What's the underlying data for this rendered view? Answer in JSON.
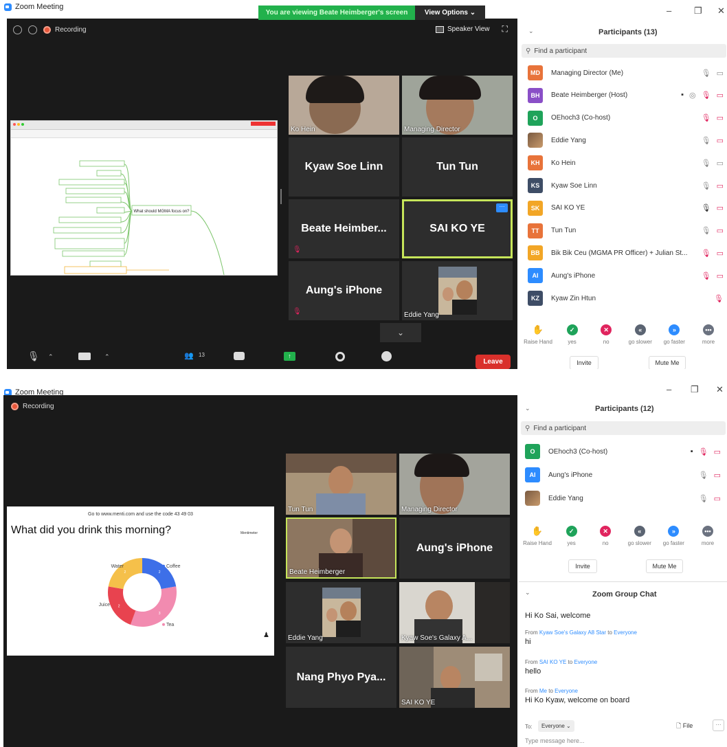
{
  "w1": {
    "title": "Zoom Meeting",
    "banner_view": "You are viewing Beate Heimberger's screen",
    "banner_options": "View Options ⌄",
    "recording": "Recording",
    "speaker_view": "Speaker View",
    "tiles": [
      {
        "name": "Ko Hein",
        "video": true
      },
      {
        "name": "Managing Director",
        "video": true
      },
      {
        "big": "Kyaw Soe Linn"
      },
      {
        "big": "Tun Tun"
      },
      {
        "big": "Beate  Heimber..."
      },
      {
        "big": "SAI KO YE"
      },
      {
        "big": "Aung's iPhone"
      },
      {
        "name": "Eddie Yang",
        "video": true
      }
    ],
    "toolbar_count": "13",
    "leave": "Leave",
    "panel_title": "Participants (13)",
    "search_placeholder": "Find a participant",
    "participants": [
      {
        "initials": "MD",
        "name": "Managing Director (Me)",
        "color": "#e8733a"
      },
      {
        "initials": "BH",
        "name": "Beate Heimberger (Host)",
        "color": "#8a4fc7"
      },
      {
        "initials": "O",
        "name": "OEhoch3 (Co-host)",
        "color": "#1fa35a"
      },
      {
        "initials": "",
        "name": "Eddie Yang",
        "color": "#9b6a4a"
      },
      {
        "initials": "KH",
        "name": "Ko Hein",
        "color": "#e8733a"
      },
      {
        "initials": "KS",
        "name": "Kyaw Soe Linn",
        "color": "#3e4d66"
      },
      {
        "initials": "SK",
        "name": "SAI KO YE",
        "color": "#f2a626"
      },
      {
        "initials": "TT",
        "name": "Tun Tun",
        "color": "#e8733a"
      },
      {
        "initials": "BB",
        "name": "Bik Bik Ceu (MGMA PR Officer) + Julian St...",
        "color": "#f2a626"
      },
      {
        "initials": "AI",
        "name": "Aung's iPhone",
        "color": "#2d8cff"
      },
      {
        "initials": "KZ",
        "name": "Kyaw Zin Htun",
        "color": "#3e4d66"
      }
    ],
    "reactions": [
      {
        "label": "Raise Hand",
        "color": "#2d8cff",
        "glyph": "✋"
      },
      {
        "label": "yes",
        "color": "#1fa35a",
        "glyph": "✓"
      },
      {
        "label": "no",
        "color": "#e0245e",
        "glyph": "✕"
      },
      {
        "label": "go slower",
        "color": "#5b6472",
        "glyph": "«"
      },
      {
        "label": "go faster",
        "color": "#2d8cff",
        "glyph": "»"
      },
      {
        "label": "more",
        "color": "#6b7280",
        "glyph": "•••"
      }
    ],
    "invite": "Invite",
    "mute_me": "Mute Me",
    "mindmap_center": "What should MGMA focus on?"
  },
  "w2": {
    "title": "Zoom Meeting",
    "recording": "Recording",
    "menti_header": "Go to www.menti.com and use the code 43 49 03",
    "menti_brand": "Mentimeter",
    "question": "What did you drink this morning?",
    "chart_data": {
      "type": "pie",
      "categories": [
        "Coffee",
        "Tea",
        "Juice",
        "Water"
      ],
      "values": [
        2,
        3,
        2,
        2
      ],
      "colors": [
        "#3d6fe8",
        "#f28bb0",
        "#e8434f",
        "#f5c04a"
      ]
    },
    "tiles": [
      {
        "name": "Tun Tun",
        "video": true
      },
      {
        "name": "Managing Director",
        "video": true
      },
      {
        "name": "Beate Heimberger",
        "video": true
      },
      {
        "big": "Aung's iPhone"
      },
      {
        "name": "Eddie Yang",
        "video": true
      },
      {
        "name": "Kyaw Soe's Galaxy A...",
        "video": true
      },
      {
        "big": "Nang  Phyo  Pya..."
      },
      {
        "name": "SAI KO YE",
        "video": true
      }
    ],
    "panel_title": "Participants (12)",
    "search_placeholder": "Find a participant",
    "participants": [
      {
        "initials": "O",
        "name": "OEhoch3 (Co-host)",
        "color": "#1fa35a"
      },
      {
        "initials": "AI",
        "name": "Aung's iPhone",
        "color": "#2d8cff"
      },
      {
        "initials": "",
        "name": "Eddie Yang",
        "color": "#9b6a4a"
      }
    ],
    "invite": "Invite",
    "mute_me": "Mute Me",
    "chat_title": "Zoom Group Chat",
    "chat": [
      {
        "from": "",
        "to": "",
        "text": "Hi Ko Sai, welcome"
      },
      {
        "from": "Kyaw Soe's Galaxy A8 Star",
        "to": "Everyone",
        "text": "hi"
      },
      {
        "from": "SAI KO YE",
        "to": "Everyone",
        "text": "hello"
      },
      {
        "from": "Me",
        "to": "Everyone",
        "text": "Hi Ko Kyaw, welcome on board"
      }
    ],
    "to_label": "To:",
    "to_value": "Everyone ⌄",
    "file_label": "File",
    "type_placeholder": "Type message here..."
  }
}
